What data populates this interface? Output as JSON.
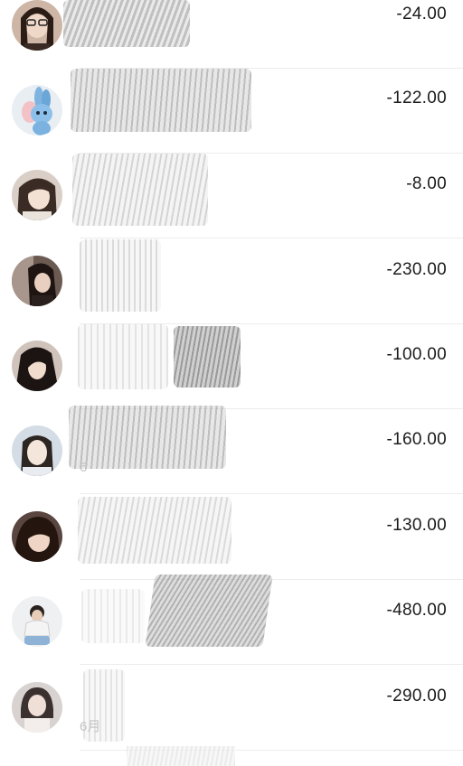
{
  "transactions": [
    {
      "amount": "-24.00",
      "avatar": "avatar-photo"
    },
    {
      "amount": "-122.00",
      "avatar": "avatar-plush-toy"
    },
    {
      "amount": "-8.00",
      "avatar": "avatar-photo"
    },
    {
      "amount": "-230.00",
      "avatar": "avatar-photo"
    },
    {
      "amount": "-100.00",
      "avatar": "avatar-photo"
    },
    {
      "amount": "-160.00",
      "avatar": "avatar-photo"
    },
    {
      "amount": "-130.00",
      "avatar": "avatar-photo"
    },
    {
      "amount": "-480.00",
      "avatar": "avatar-photo"
    },
    {
      "amount": "-290.00",
      "avatar": "avatar-photo"
    }
  ],
  "partial_text": {
    "row6_date": "6",
    "row9_date": "6月"
  },
  "colors": {
    "amount_text": "#1c1c1c",
    "divider": "#ececec",
    "redaction": "#9a9a9a",
    "background": "#ffffff"
  }
}
